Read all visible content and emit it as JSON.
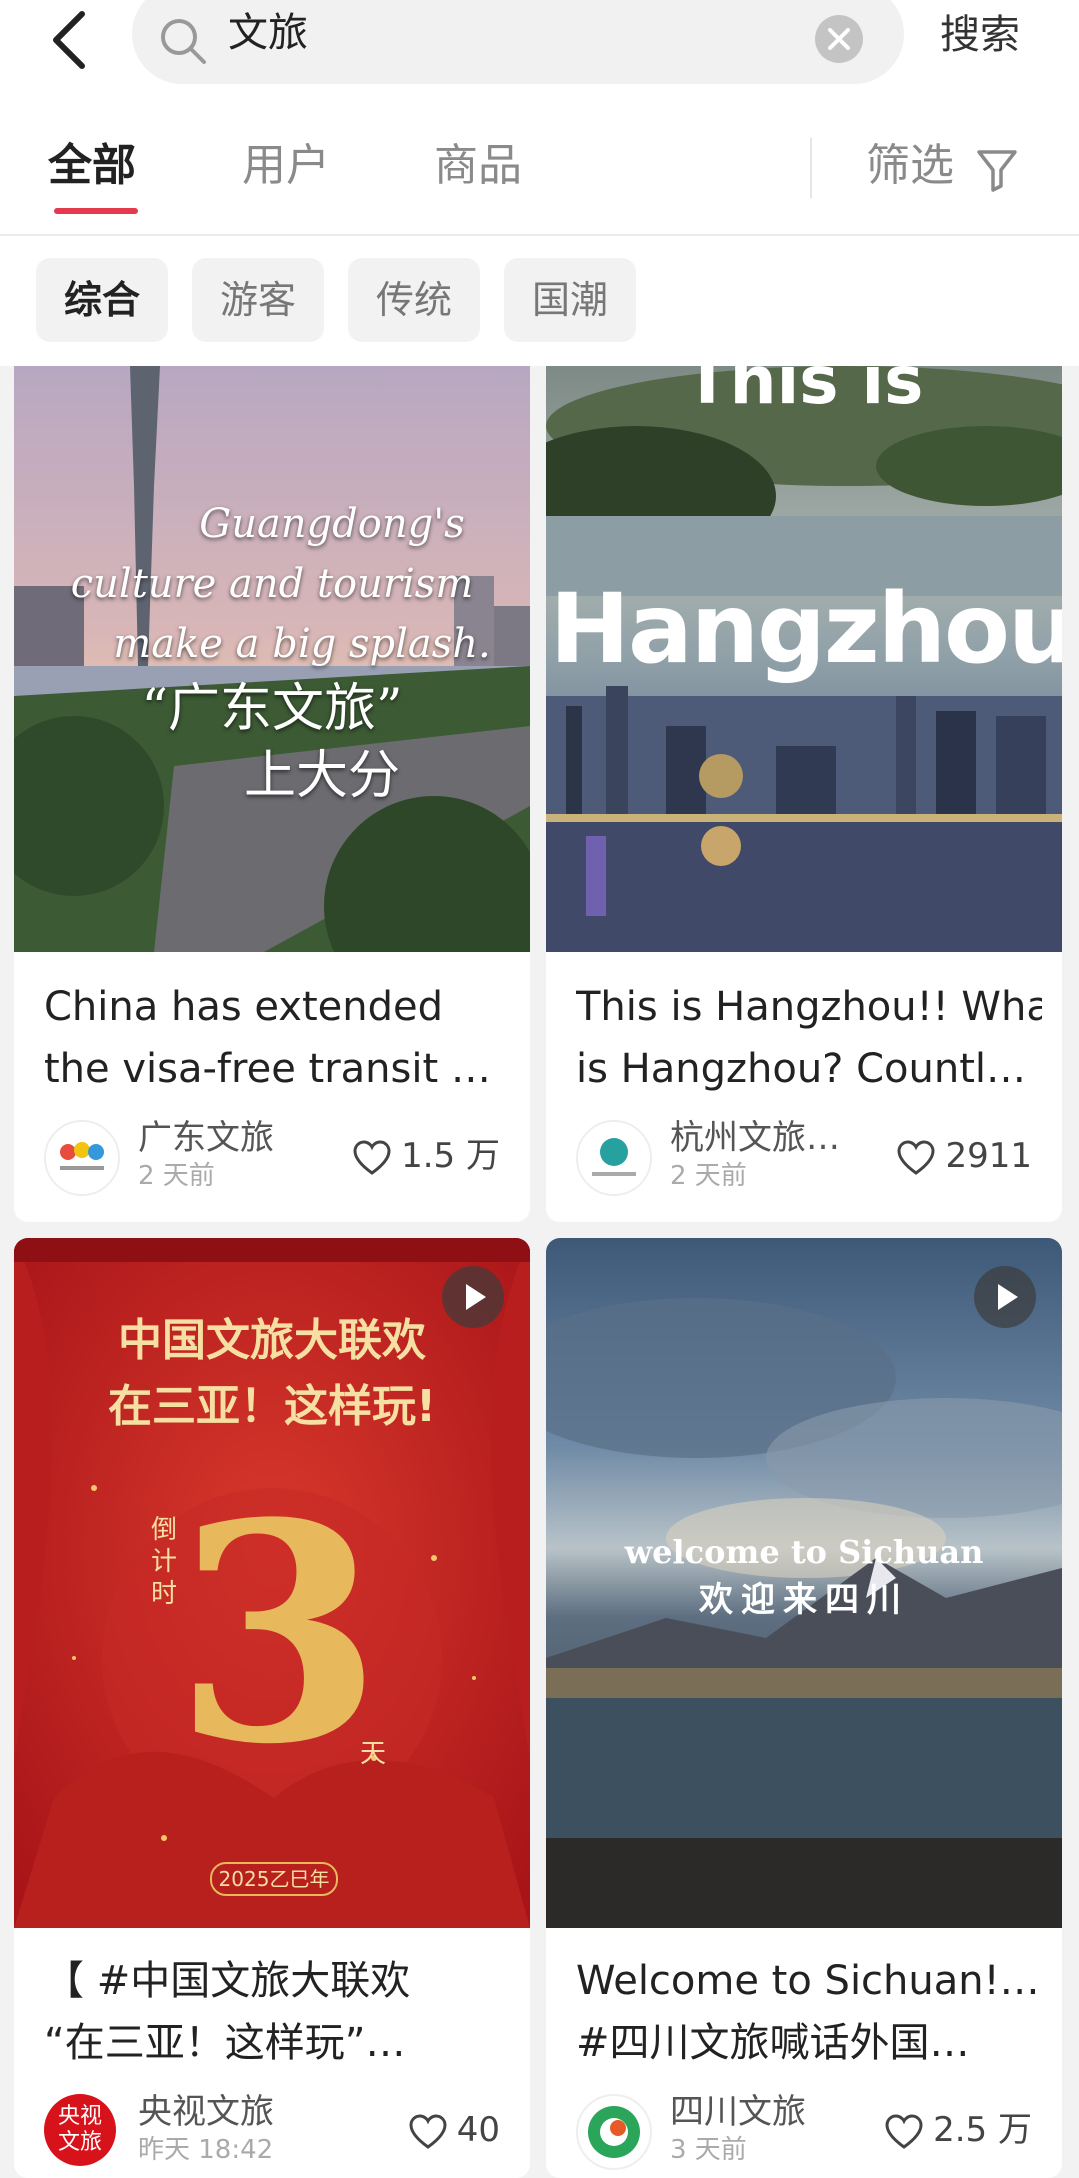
{
  "search": {
    "query": "文旅",
    "button_label": "搜索"
  },
  "tabs": [
    {
      "label": "全部"
    },
    {
      "label": "用户"
    },
    {
      "label": "商品"
    }
  ],
  "filter_label": "筛选",
  "chips": [
    "综合",
    "游客",
    "传统",
    "国潮"
  ],
  "accent_color": "#e4394f",
  "cards": [
    {
      "overlay_lines": [
        "Guangdong's",
        "culture and tourism",
        "make a big splash.",
        "“广东文旅”",
        "上大分"
      ],
      "title_lines": [
        "China has extended",
        "the visa-free transit …"
      ],
      "author": "广东文旅",
      "time": "2 天前",
      "likes": "1.5 万"
    },
    {
      "overlay_lines": [
        "This is",
        "Hangzhou"
      ],
      "title_lines": [
        "This is Hangzhou!! What",
        "is Hangzhou? Countl…"
      ],
      "author": "杭州文旅…",
      "time": "2 天前",
      "likes": "2911"
    },
    {
      "overlay_lines": [
        "中国文旅大联欢",
        "在三亚！这样玩!",
        "倒",
        "计",
        "时",
        "3",
        "天",
        "2025乙巳年"
      ],
      "title_lines": [
        "【 #中国文旅大联欢",
        "“在三亚！这样玩”…"
      ],
      "author": "央视文旅",
      "avatar_text": [
        "央视",
        "文旅"
      ],
      "time": "昨天 18:42",
      "likes": "40"
    },
    {
      "overlay_lines": [
        "welcome to Sichuan",
        "欢迎来四川"
      ],
      "title_lines": [
        "Welcome to Sichuan!…",
        "#四川文旅喊话外国…"
      ],
      "author": "四川文旅",
      "time": "3 天前",
      "likes": "2.5 万"
    }
  ]
}
